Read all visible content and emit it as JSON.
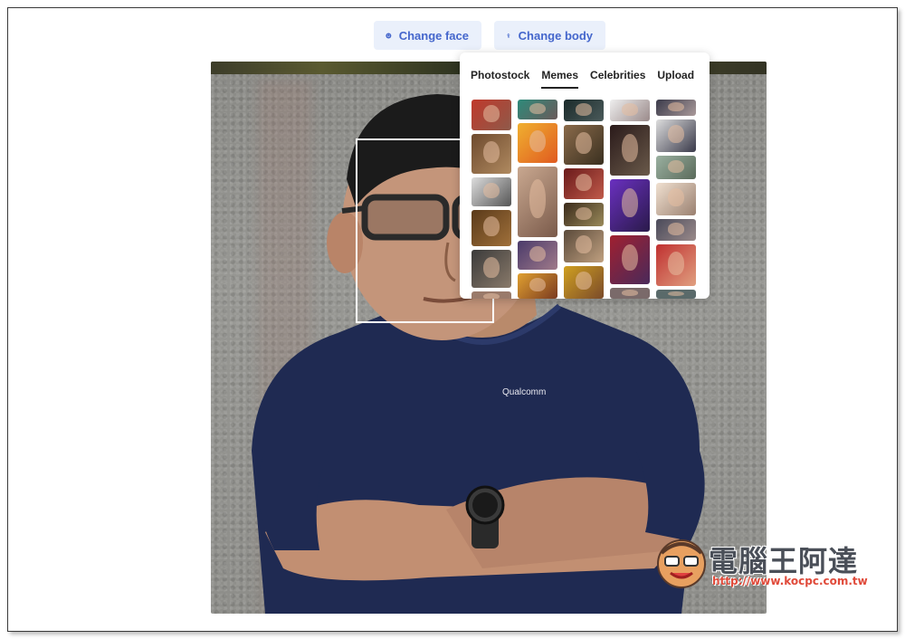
{
  "toolbar": {
    "change_face_label": "Change face",
    "change_body_label": "Change body"
  },
  "picker": {
    "tabs": [
      {
        "label": "Photostock",
        "active": false
      },
      {
        "label": "Memes",
        "active": true
      },
      {
        "label": "Celebrities",
        "active": false
      },
      {
        "label": "Upload",
        "active": false
      }
    ]
  },
  "watermark": {
    "title": "電腦王阿達",
    "url": "http://www.kocpc.com.tw"
  },
  "shirt_print": "Qualcomm",
  "colors": {
    "accent": "#4466cc",
    "button_bg": "#eaf0fb",
    "shirt": "#1f2a52"
  },
  "icons": {
    "change_face": "smiley-face-icon",
    "change_body": "person-figure-icon"
  }
}
